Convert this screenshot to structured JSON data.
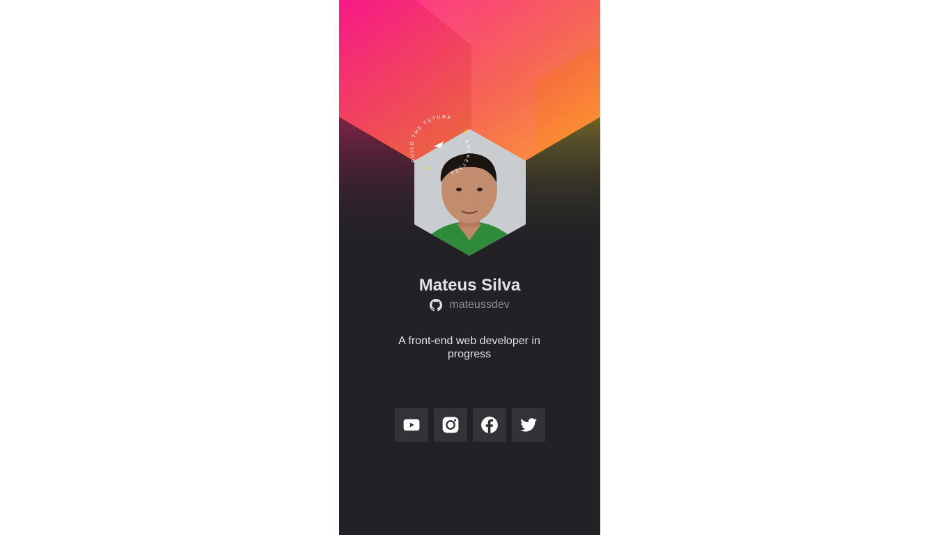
{
  "profile": {
    "name": "Mateus Silva",
    "github_username": "mateussdev",
    "bio": "A front-end web developer in progress",
    "badge_text": "BUILD THE FUTURE",
    "badge_brand": "ROCKETSEAT"
  },
  "socials": [
    {
      "icon": "youtube-icon",
      "label": "YouTube"
    },
    {
      "icon": "instagram-icon",
      "label": "Instagram"
    },
    {
      "icon": "facebook-icon",
      "label": "Facebook"
    },
    {
      "icon": "twitter-icon",
      "label": "Twitter"
    }
  ],
  "colors": {
    "page_background": "#ffffff",
    "card_background": "#222226",
    "gradient_start": "#ff1a8c",
    "gradient_end": "#ffa726",
    "name_text": "#e1e1e6",
    "muted_text": "#8d8d99",
    "social_button": "#323238"
  }
}
